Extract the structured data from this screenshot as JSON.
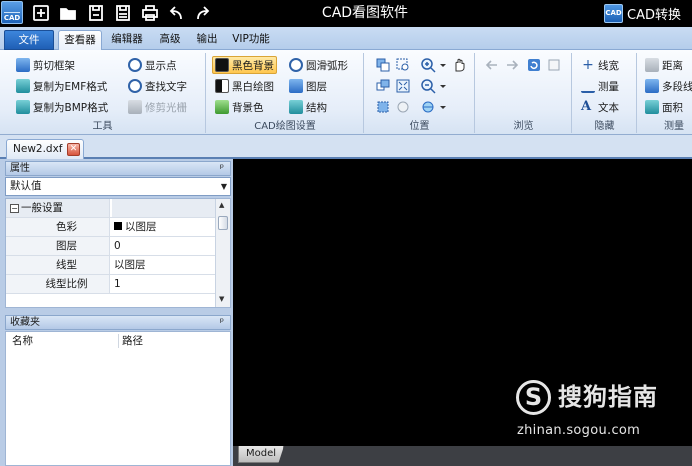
{
  "titlebar": {
    "logo_text": "CAD",
    "app_title": "CAD看图软件",
    "convert_label": "CAD转换",
    "convert_icon_text": "CAD",
    "quick_access_icons": [
      "new-icon",
      "open-folder-icon",
      "save-icon",
      "save-as-icon",
      "print-icon",
      "undo-icon",
      "redo-icon"
    ]
  },
  "menu": {
    "tabs": [
      "文件",
      "查看器",
      "编辑器",
      "高级",
      "输出",
      "VIP功能"
    ],
    "active_tab": "查看器"
  },
  "ribbon": {
    "tools": {
      "label": "工具",
      "buttons": [
        "剪切框架",
        "显示点",
        "复制为EMF格式",
        "查找文字",
        "复制为BMP格式",
        "修剪光栅"
      ]
    },
    "cad_settings": {
      "label": "CAD绘图设置",
      "buttons": [
        "黑色背景",
        "圆滑弧形",
        "黑白绘图",
        "图层",
        "背景色",
        "结构"
      ]
    },
    "position": {
      "label": "位置"
    },
    "browse": {
      "label": "浏览"
    },
    "hide": {
      "label": "隐藏",
      "buttons": [
        "线宽",
        "测量",
        "文本"
      ]
    },
    "measure": {
      "label": "测量",
      "buttons": [
        "距离",
        "多段线",
        "面积"
      ]
    }
  },
  "document": {
    "tab_label": "New2.dxf",
    "close_glyph": "✕"
  },
  "properties": {
    "header": "属性",
    "pin_glyph": "ᵖ",
    "combo_value": "默认值",
    "category": "一般设置",
    "rows": [
      {
        "key": "色彩",
        "value": "以图层"
      },
      {
        "key": "图层",
        "value": "0"
      },
      {
        "key": "线型",
        "value": "以图层"
      },
      {
        "key": "线型比例",
        "value": "1"
      }
    ]
  },
  "favorites": {
    "header": "收藏夹",
    "columns": [
      "名称",
      "路径"
    ]
  },
  "canvas": {
    "background": "#000000",
    "model_tab": "Model"
  },
  "watermark": {
    "logo_glyph": "S",
    "title": "搜狗指南",
    "url": "zhinan.sogou.com"
  }
}
